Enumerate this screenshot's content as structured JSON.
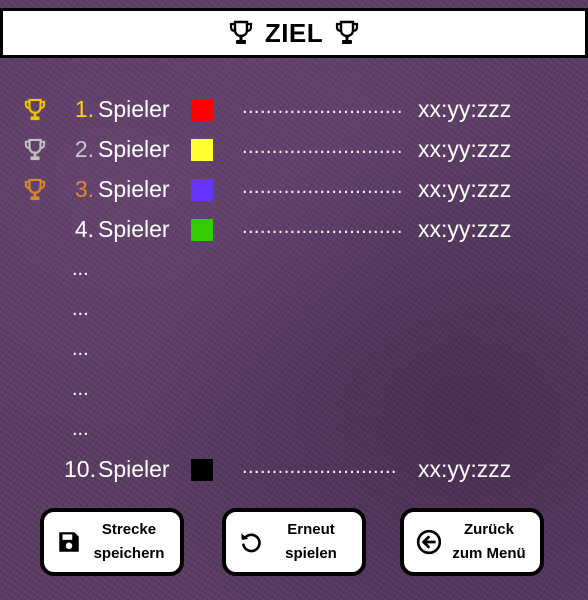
{
  "header": {
    "title": "ZIEL",
    "icon_left": "trophy-icon",
    "icon_right": "trophy-icon"
  },
  "leaderboard": {
    "rows": [
      {
        "rank": "1.",
        "name": "Spieler",
        "dots": "...........................",
        "time": "xx:yy:zzz",
        "color": "#ff0000",
        "rank_color": "#ffd400",
        "trophy": "gold-trophy-icon",
        "trophy_color": "#f2c200"
      },
      {
        "rank": "2.",
        "name": "Spieler",
        "dots": "...........................",
        "time": "xx:yy:zzz",
        "color": "#ffff33",
        "rank_color": "#c8c8c8",
        "trophy": "silver-trophy-icon",
        "trophy_color": "#c0c0c0"
      },
      {
        "rank": "3.",
        "name": "Spieler",
        "dots": "...........................",
        "time": "xx:yy:zzz",
        "color": "#6633ff",
        "rank_color": "#e08a2e",
        "trophy": "bronze-trophy-icon",
        "trophy_color": "#d4892a"
      },
      {
        "rank": "4.",
        "name": "Spieler",
        "dots": "...........................",
        "time": "xx:yy:zzz",
        "color": "#33cc00",
        "rank_color": "#ffffff"
      }
    ],
    "ellipsis": [
      "...",
      "...",
      "...",
      "...",
      "..."
    ],
    "last_row": {
      "rank": "10.",
      "name": "Spieler",
      "dots": "..........................",
      "time": "xx:yy:zzz",
      "color": "#000000",
      "rank_color": "#ffffff"
    }
  },
  "buttons": {
    "save": {
      "line1": "Strecke",
      "line2": "speichern",
      "icon": "save-icon"
    },
    "replay": {
      "line1": "Erneut",
      "line2": "spielen",
      "icon": "restart-icon"
    },
    "back": {
      "line1": "Zurück",
      "line2": "zum Menü",
      "icon": "back-arrow-icon"
    }
  }
}
